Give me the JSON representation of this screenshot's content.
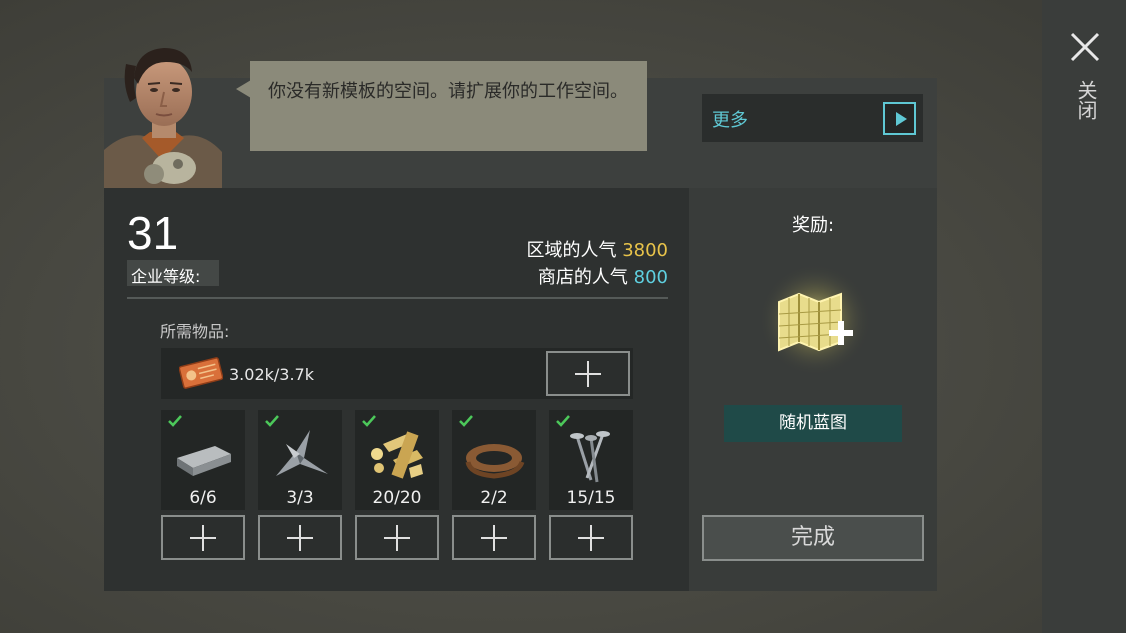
{
  "dialog": {
    "message": "你没有新模板的空间。请扩展你的工作空间。",
    "more_label": "更多",
    "close_label": "关闭"
  },
  "company": {
    "level": "31",
    "level_label": "企业等级:",
    "region_popularity_label": "区域的人气",
    "region_popularity_value": "3800",
    "shop_popularity_label": "商店的人气",
    "shop_popularity_value": "800"
  },
  "requirements": {
    "label": "所需物品:",
    "coupon": {
      "icon": "coupon-icon",
      "amount": "3.02k/3.7k"
    },
    "items": [
      {
        "icon": "metal-ingot-icon",
        "count": "6/6",
        "done": true
      },
      {
        "icon": "metal-scrap-icon",
        "count": "3/3",
        "done": true
      },
      {
        "icon": "wood-parts-icon",
        "count": "20/20",
        "done": true
      },
      {
        "icon": "leather-strip-icon",
        "count": "2/2",
        "done": true
      },
      {
        "icon": "nails-icon",
        "count": "15/15",
        "done": true
      }
    ]
  },
  "reward": {
    "title": "奖励:",
    "icon": "blueprint-map-plus-icon",
    "name": "随机蓝图"
  },
  "actions": {
    "complete_label": "完成"
  },
  "colors": {
    "accent_cyan": "#5fc8d4",
    "accent_yellow": "#e8c34a",
    "check_green": "#4cc85a",
    "reward_bg": "#1f4a48"
  }
}
